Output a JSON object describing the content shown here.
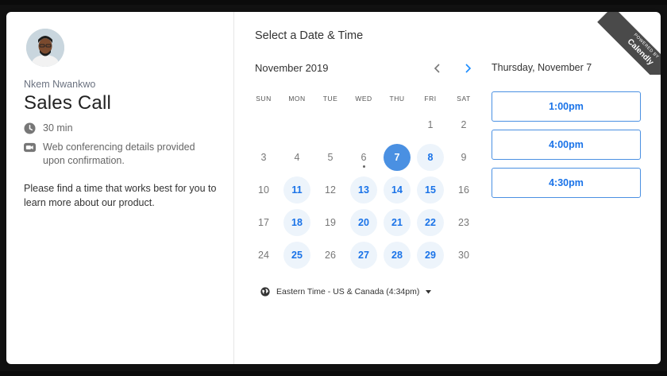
{
  "event": {
    "host_name": "Nkem Nwankwo",
    "title": "Sales Call",
    "duration": "30 min",
    "conferencing_note": "Web conferencing details provided upon confirmation.",
    "description": "Please find a time that works best for you to learn more about our product."
  },
  "picker": {
    "heading": "Select a Date & Time",
    "month_label": "November 2019",
    "prev_icon": "chevron-left-icon",
    "next_icon": "chevron-right-icon",
    "weekdays": [
      "SUN",
      "MON",
      "TUE",
      "WED",
      "THU",
      "FRI",
      "SAT"
    ],
    "weeks": [
      [
        null,
        null,
        null,
        null,
        null,
        {
          "d": "1",
          "s": "off"
        },
        {
          "d": "2",
          "s": "off"
        }
      ],
      [
        {
          "d": "3",
          "s": "off"
        },
        {
          "d": "4",
          "s": "off"
        },
        {
          "d": "5",
          "s": "off"
        },
        {
          "d": "6",
          "s": "today"
        },
        {
          "d": "7",
          "s": "selected"
        },
        {
          "d": "8",
          "s": "avail"
        },
        {
          "d": "9",
          "s": "off"
        }
      ],
      [
        {
          "d": "10",
          "s": "off"
        },
        {
          "d": "11",
          "s": "avail"
        },
        {
          "d": "12",
          "s": "off"
        },
        {
          "d": "13",
          "s": "avail"
        },
        {
          "d": "14",
          "s": "avail"
        },
        {
          "d": "15",
          "s": "avail"
        },
        {
          "d": "16",
          "s": "off"
        }
      ],
      [
        {
          "d": "17",
          "s": "off"
        },
        {
          "d": "18",
          "s": "avail"
        },
        {
          "d": "19",
          "s": "off"
        },
        {
          "d": "20",
          "s": "avail"
        },
        {
          "d": "21",
          "s": "avail"
        },
        {
          "d": "22",
          "s": "avail"
        },
        {
          "d": "23",
          "s": "off"
        }
      ],
      [
        {
          "d": "24",
          "s": "off"
        },
        {
          "d": "25",
          "s": "avail"
        },
        {
          "d": "26",
          "s": "off"
        },
        {
          "d": "27",
          "s": "avail"
        },
        {
          "d": "28",
          "s": "avail"
        },
        {
          "d": "29",
          "s": "avail"
        },
        {
          "d": "30",
          "s": "off"
        }
      ]
    ],
    "timezone": "Eastern Time - US & Canada (4:34pm)",
    "selected_date_label": "Thursday, November 7",
    "slots": [
      "1:00pm",
      "4:00pm",
      "4:30pm"
    ]
  },
  "ribbon": {
    "powered_by": "POWERED BY",
    "brand": "Calendly"
  },
  "colors": {
    "accent": "#4a90e2",
    "link": "#1a73e8",
    "available_bg": "#edf4fb"
  },
  "icons": {
    "clock": "clock-icon",
    "video": "video-camera-icon",
    "globe": "globe-icon",
    "caret": "caret-down-icon"
  }
}
